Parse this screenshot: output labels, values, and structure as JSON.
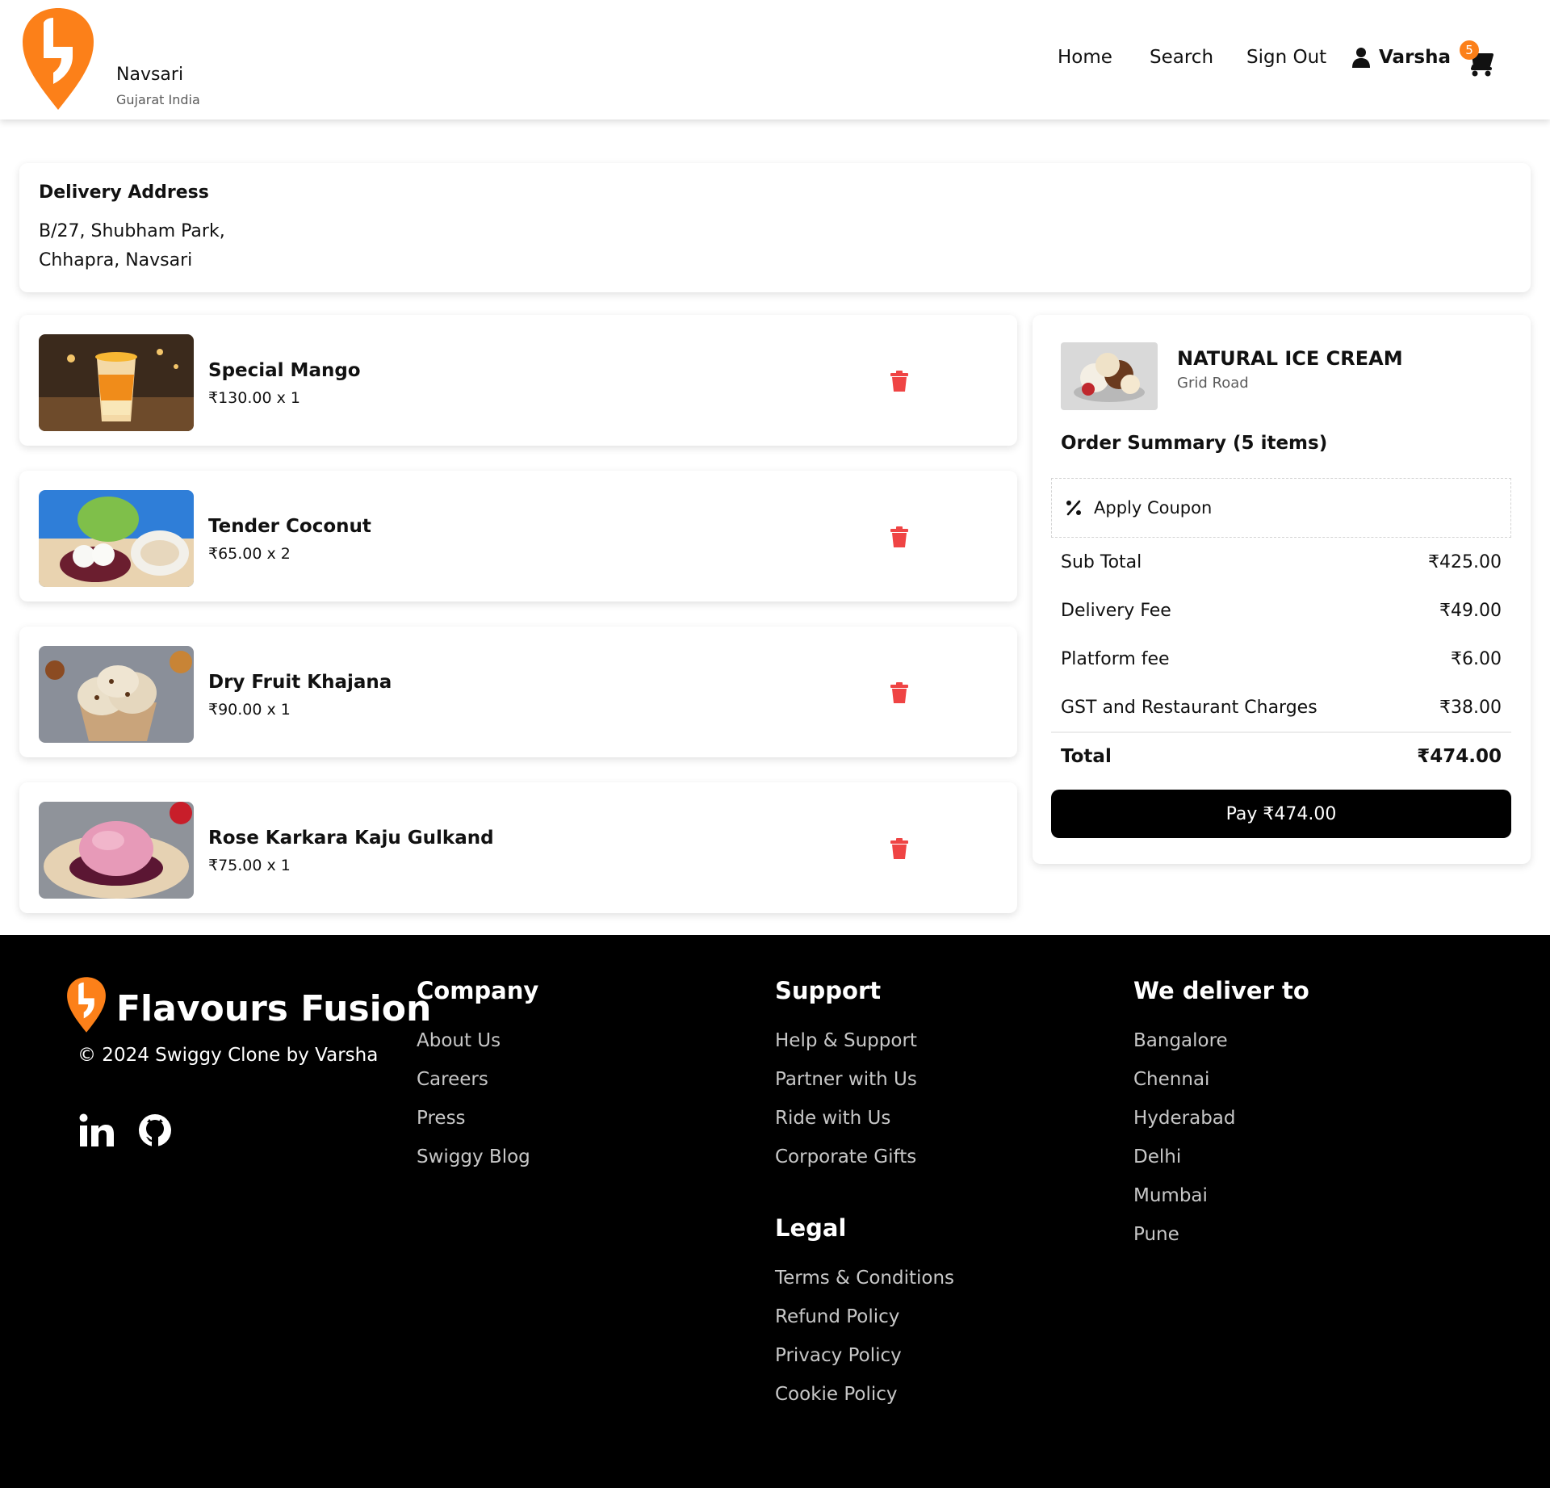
{
  "header": {
    "city": "Navsari",
    "region": "Gujarat India",
    "nav": {
      "home": "Home",
      "search": "Search",
      "sign_out": "Sign Out"
    },
    "user_name": "Varsha",
    "cart_count": "5",
    "accent_color": "#fc8019"
  },
  "address": {
    "title": "Delivery Address",
    "line1": "B/27, Shubham Park,",
    "line2": "Chhapra, Navsari"
  },
  "cart_items": [
    {
      "name": "Special Mango",
      "price": "₹130.00 x 1",
      "image": "mango-drink-image"
    },
    {
      "name": "Tender Coconut",
      "price": "₹65.00 x 2",
      "image": "tender-coconut-image"
    },
    {
      "name": "Dry Fruit Khajana",
      "price": "₹90.00 x 1",
      "image": "dry-fruit-icecream-image"
    },
    {
      "name": "Rose Karkara Kaju Gulkand",
      "price": "₹75.00 x 1",
      "image": "rose-icecream-image"
    }
  ],
  "summary": {
    "restaurant_name": "NATURAL ICE CREAM",
    "restaurant_location": "Grid Road",
    "title": "Order Summary (5 items)",
    "coupon_label": "Apply Coupon",
    "rows": [
      {
        "label": "Sub Total",
        "value": "₹425.00"
      },
      {
        "label": "Delivery Fee",
        "value": "₹49.00"
      },
      {
        "label": "Platform fee",
        "value": "₹6.00"
      },
      {
        "label": "GST and Restaurant Charges",
        "value": "₹38.00"
      }
    ],
    "total_label": "Total",
    "total_value": "₹474.00",
    "pay_label": "Pay ₹474.00",
    "delete_color": "#ef4444"
  },
  "footer": {
    "brand": "Flavours Fusion",
    "copyright": "© 2024 Swiggy Clone by Varsha",
    "social": [
      "linkedin-icon",
      "github-icon"
    ],
    "company": {
      "heading": "Company",
      "links": [
        "About Us",
        "Careers",
        "Press",
        "Swiggy Blog"
      ]
    },
    "support": {
      "heading": "Support",
      "links": [
        "Help & Support",
        "Partner with Us",
        "Ride with Us",
        "Corporate Gifts"
      ]
    },
    "legal": {
      "heading": "Legal",
      "links": [
        "Terms & Conditions",
        "Refund Policy",
        "Privacy Policy",
        "Cookie Policy"
      ]
    },
    "deliver": {
      "heading": "We deliver to",
      "links": [
        "Bangalore",
        "Chennai",
        "Hyderabad",
        "Delhi",
        "Mumbai",
        "Pune"
      ]
    }
  }
}
